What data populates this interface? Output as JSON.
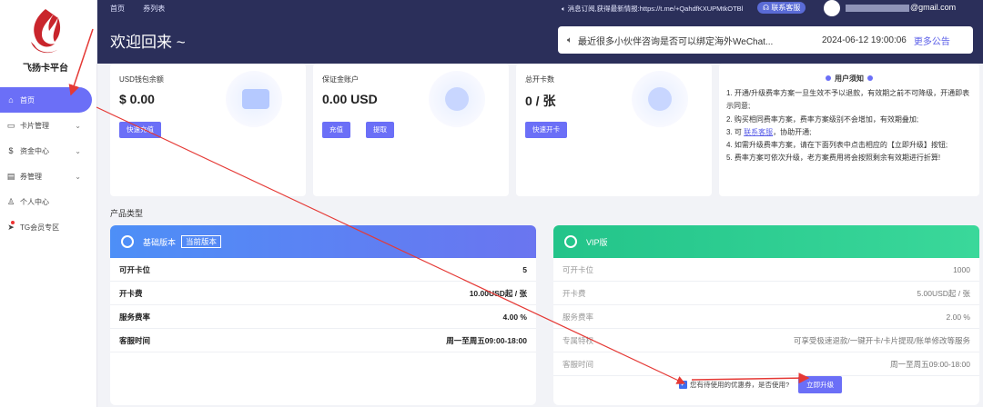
{
  "brand": {
    "name": "飞扬卡平台"
  },
  "sidebar": {
    "items": [
      {
        "label": "首页",
        "icon": "home-icon",
        "active": true
      },
      {
        "label": "卡片管理",
        "icon": "card-icon",
        "has_submenu": true
      },
      {
        "label": "资金中心",
        "icon": "dollar-icon",
        "has_submenu": true
      },
      {
        "label": "券管理",
        "icon": "coupon-icon",
        "has_submenu": true
      },
      {
        "label": "个人中心",
        "icon": "user-icon"
      },
      {
        "label": "TG会员专区",
        "icon": "telegram-icon"
      }
    ]
  },
  "header": {
    "breadcrumbs": [
      "首页",
      "券列表"
    ],
    "subscribe_text": "消息订阅,获得最新情报:https://t.me/+QahdfKXUPMtkOTBl",
    "support_label": "联系客服",
    "email_suffix": "@gmail.com",
    "welcome": "欢迎回来 ~"
  },
  "announcement": {
    "text": "最近很多小伙伴咨询是否可以绑定海外WeChat...",
    "date": "2024-06-12 19:00:06",
    "more_label": "更多公告"
  },
  "stats": {
    "usd_wallet": {
      "title": "USD钱包余额",
      "value": "$ 0.00",
      "btn": "快速充值"
    },
    "deposit": {
      "title": "保证金账户",
      "value": "0.00 USD",
      "btn_topup": "充值",
      "btn_withdraw": "提取"
    },
    "cards": {
      "title": "总开卡数",
      "value": "0 / 张",
      "btn": "快速开卡"
    }
  },
  "notes": {
    "title": "用户须知",
    "lines": [
      "1. 开通/升级费率方案一旦生效不予以退款，有效期之前不可降级，开通即表示同意;",
      "2. 购买相同费率方案，费率方案级别不会增加，有效期叠加;",
      "3. 可",
      "联系客服",
      "，协助开通;",
      "4. 如需升级费率方案，请在下面列表中点击相应的【立即升级】按钮;",
      "5. 费率方案可依次升级，老方案费用将会按照剩余有效期进行折算!"
    ]
  },
  "section": {
    "title": "产品类型"
  },
  "plans": {
    "basic": {
      "name": "基础版本",
      "tag": "当前版本",
      "rows": [
        {
          "k": "可开卡位",
          "v": "5"
        },
        {
          "k": "开卡费",
          "v": "10.00USD起 / 张"
        },
        {
          "k": "服务费率",
          "v": "4.00 %"
        },
        {
          "k": "客服时间",
          "v": "周一至周五09:00-18:00"
        }
      ]
    },
    "vip": {
      "name": "VIP版",
      "rows": [
        {
          "k": "可开卡位",
          "v": "1000"
        },
        {
          "k": "开卡费",
          "v": "5.00USD起 / 张"
        },
        {
          "k": "服务费率",
          "v": "2.00 %"
        },
        {
          "k": "专属特权",
          "v": "可享受极速退款/一键开卡/卡片提现/账单修改等服务"
        },
        {
          "k": "客服时间",
          "v": "周一至周五09:00-18:00"
        }
      ],
      "coupon_text": "您有待使用的优惠券，是否使用?",
      "upgrade_label": "立即升级"
    }
  },
  "colors": {
    "accent": "#6b6ff7",
    "header_bg": "#2b2f5a",
    "basic": "#4d8ff7",
    "vip": "#23c48a",
    "annotation": "#e53935"
  }
}
